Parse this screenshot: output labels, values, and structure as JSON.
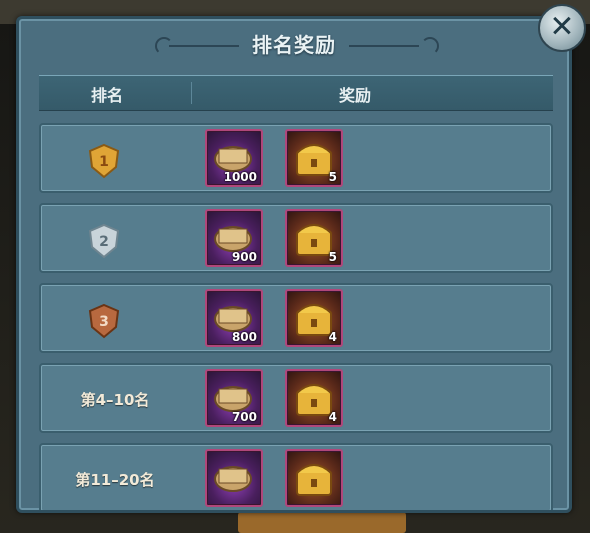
{
  "title": "排名奖励",
  "header": {
    "rank_label": "排名",
    "reward_label": "奖励"
  },
  "rows": [
    {
      "rank_badge": "1",
      "badge_color": "#e0a536",
      "rewards": [
        {
          "icon": "scroll-icon",
          "count": "1000"
        },
        {
          "icon": "chest-icon",
          "count": "5"
        }
      ]
    },
    {
      "rank_badge": "2",
      "badge_color": "#c9d4da",
      "rewards": [
        {
          "icon": "scroll-icon",
          "count": "900"
        },
        {
          "icon": "chest-icon",
          "count": "5"
        }
      ]
    },
    {
      "rank_badge": "3",
      "badge_color": "#b8693f",
      "rewards": [
        {
          "icon": "scroll-icon",
          "count": "800"
        },
        {
          "icon": "chest-icon",
          "count": "4"
        }
      ]
    },
    {
      "rank_text": "第4–10名",
      "rewards": [
        {
          "icon": "scroll-icon",
          "count": "700"
        },
        {
          "icon": "chest-icon",
          "count": "4"
        }
      ]
    },
    {
      "rank_text": "第11–20名",
      "rewards": [
        {
          "icon": "scroll-icon",
          "count": ""
        },
        {
          "icon": "chest-icon",
          "count": ""
        }
      ]
    }
  ],
  "close_icon": "close-icon",
  "colors": {
    "panel": "#4b6e7f",
    "row": "#567d8e",
    "item_border": "#b0477a"
  }
}
